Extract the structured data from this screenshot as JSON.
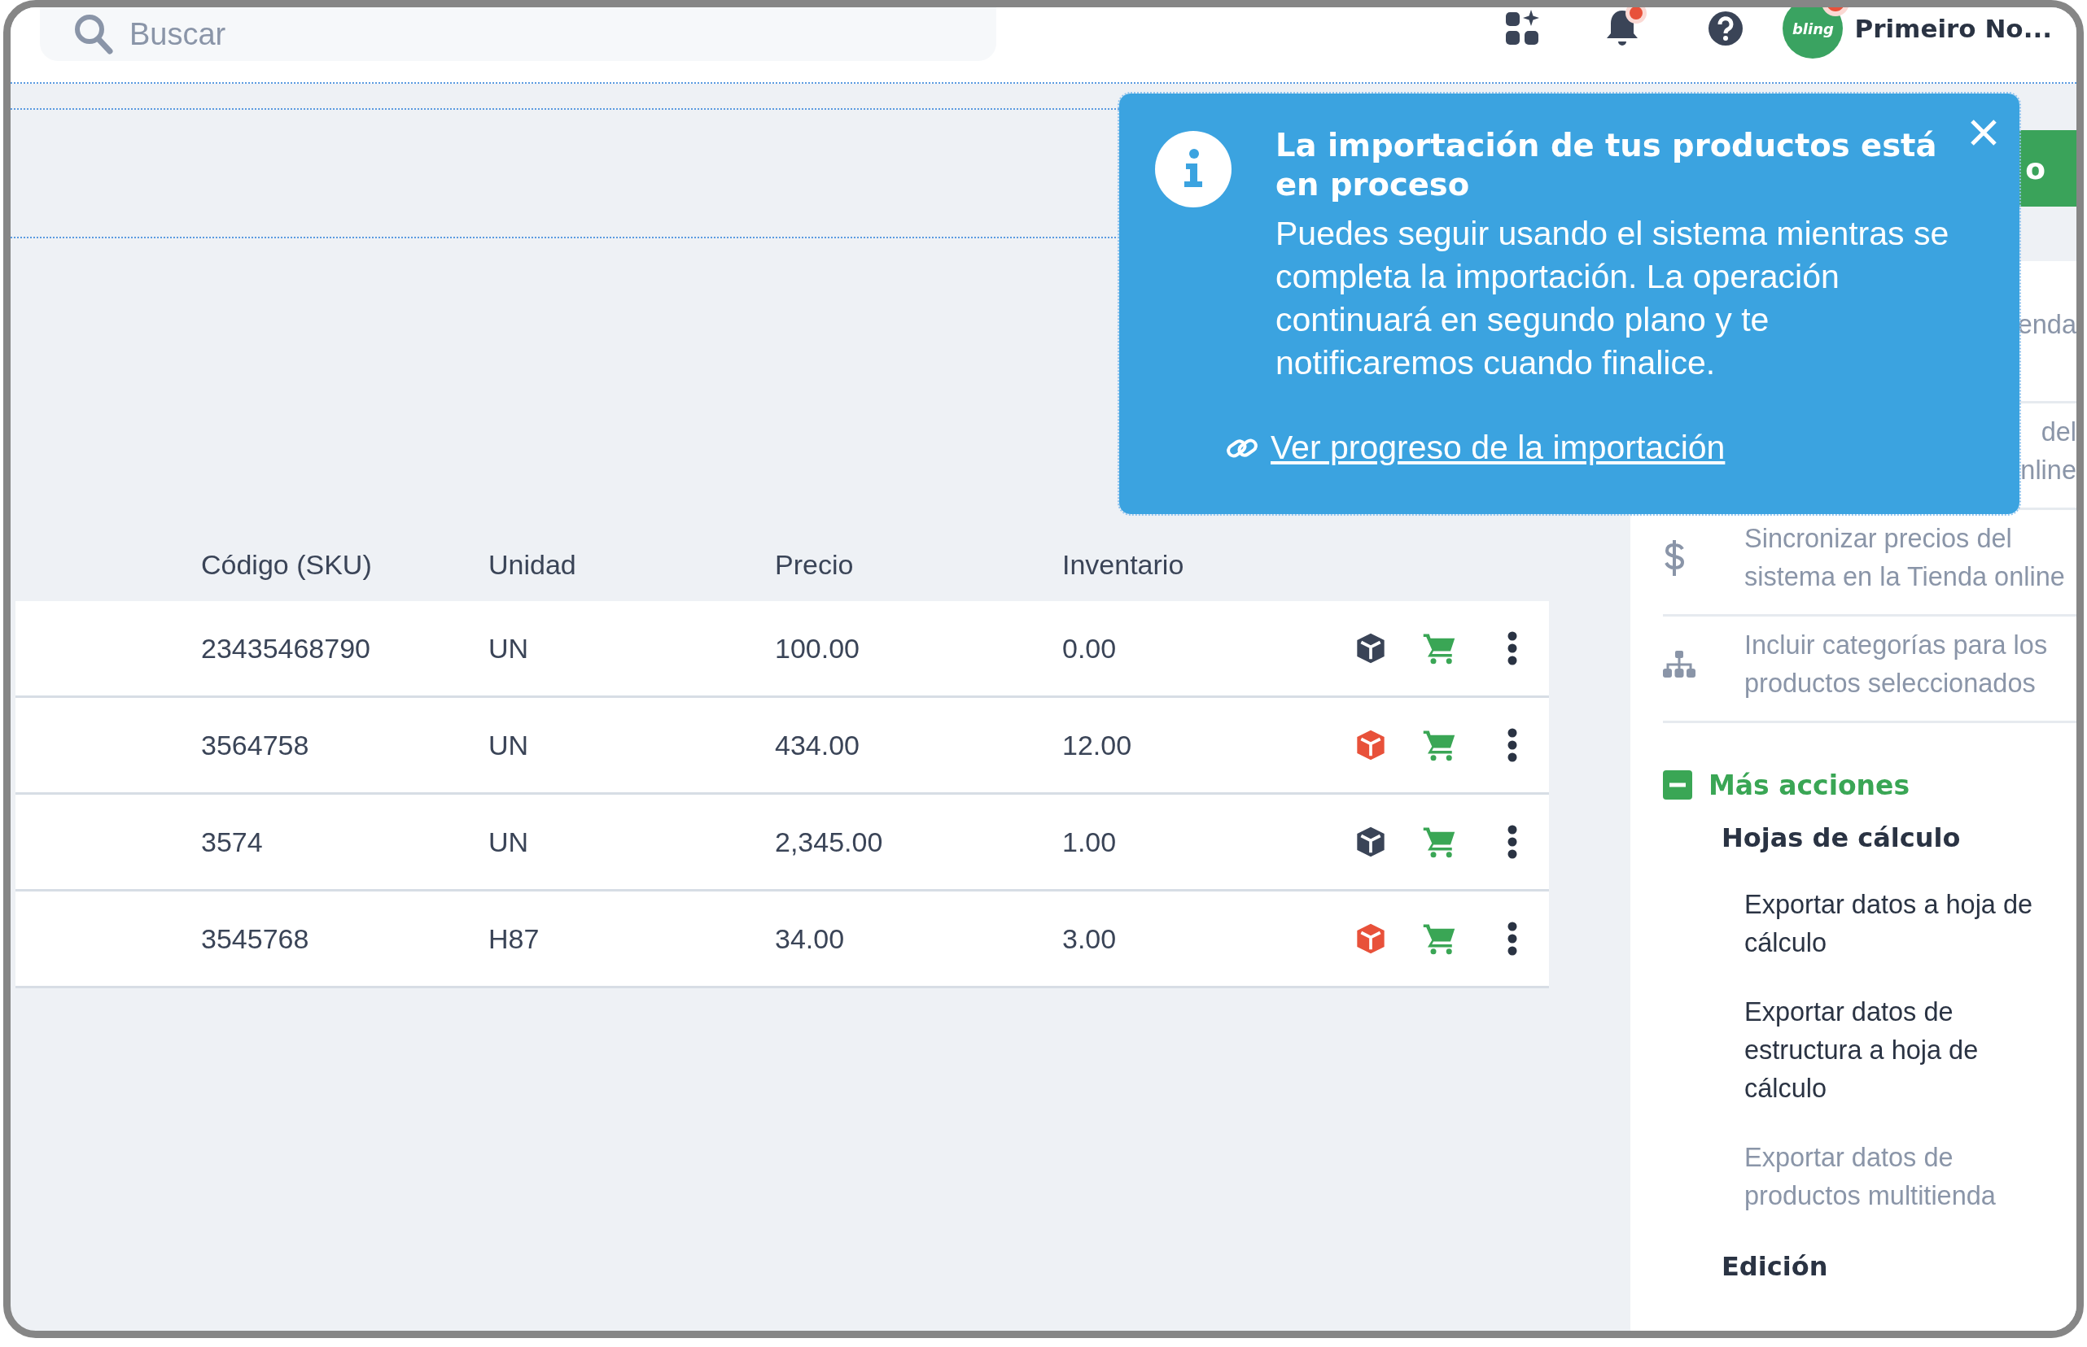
{
  "search": {
    "placeholder": "Buscar"
  },
  "header": {
    "notifications_unread": true,
    "account": {
      "logo_text": "bling",
      "unread": true,
      "name": "Primeiro No..."
    }
  },
  "toolbar_button": {
    "label": "o"
  },
  "table": {
    "columns": [
      "Código (SKU)",
      "Unidad",
      "Precio",
      "Inventario"
    ],
    "rows": [
      {
        "sku": "23435468790",
        "unit": "UN",
        "price": "100.00",
        "stock": "0.00",
        "color": "#3a4457"
      },
      {
        "sku": "3564758",
        "unit": "UN",
        "price": "434.00",
        "stock": "12.00",
        "color": "#e8513a"
      },
      {
        "sku": "3574",
        "unit": "UN",
        "price": "2,345.00",
        "stock": "1.00",
        "color": "#3a4457"
      },
      {
        "sku": "3545768",
        "unit": "H87",
        "price": "34.00",
        "stock": "3.00",
        "color": "#e8513a"
      }
    ]
  },
  "sidebar": {
    "covered_items": [
      {
        "lines": [
          "enda"
        ]
      },
      {
        "lines": [
          "del",
          "nline"
        ]
      }
    ],
    "items": [
      {
        "kind": "dollar",
        "text": "Sincronizar precios del sistema en la Tienda online",
        "disabled": true
      },
      {
        "kind": "hierarchy",
        "text": "Incluir categorías para los productos seleccionados",
        "disabled": true
      }
    ],
    "more_actions": {
      "title": "Más acciones",
      "expanded": true,
      "groups": [
        {
          "title": "Hojas de cálculo",
          "items": [
            {
              "text": "Exportar datos a hoja de cálculo",
              "disabled": false
            },
            {
              "text": "Exportar datos de estructura a hoja de cálculo",
              "disabled": false
            },
            {
              "text": "Exportar datos de productos multitienda",
              "disabled": true
            }
          ]
        },
        {
          "title": "Edición"
        }
      ]
    }
  },
  "toast": {
    "title": "La importación de tus productos está en proceso",
    "message": "Puedes seguir usando el sistema mientras se completa la importación. La operación continuará en segundo plano y te notificaremos cuando finalice.",
    "link": "Ver progreso de la importación"
  }
}
